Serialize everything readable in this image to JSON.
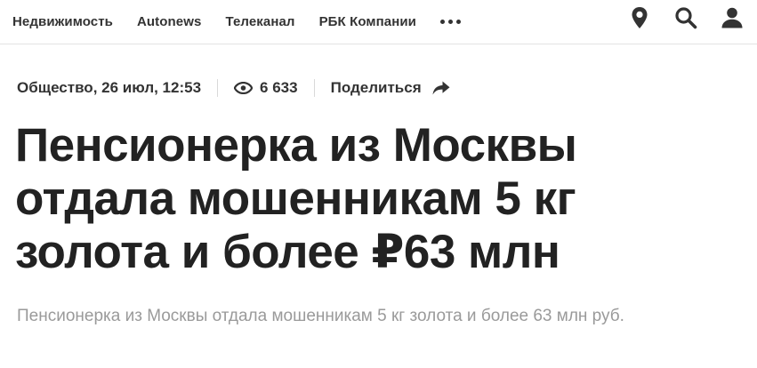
{
  "nav": {
    "items": [
      {
        "label": "Недвижимость"
      },
      {
        "label": "Autonews"
      },
      {
        "label": "Телеканал"
      },
      {
        "label": "РБК Компании"
      }
    ],
    "more_icon": "more-dots-icon",
    "icons": [
      "location-pin-icon",
      "search-icon",
      "user-icon"
    ]
  },
  "article": {
    "meta": {
      "category_date": "Общество, 26 июл, 12:53",
      "views": "6 633",
      "share_label": "Поделиться"
    },
    "headline": "Пенсионерка из Москвы отдала мошенникам 5 кг золота и более ₽63 млн",
    "lead": "Пенсионерка из Москвы отдала мошенникам 5 кг золота и более 63 млн руб."
  },
  "colors": {
    "text": "#222222",
    "lead": "#9a9a9a",
    "divider": "#e3e3e3"
  }
}
